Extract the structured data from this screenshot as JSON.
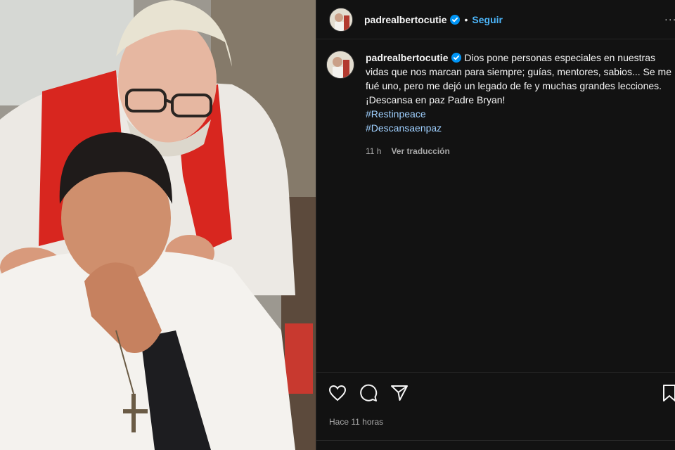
{
  "header": {
    "username": "padrealbertocutie",
    "separator": "•",
    "follow_label": "Seguir",
    "more_label": "..."
  },
  "post": {
    "image_icon": "photo-priest-blessing",
    "caption": {
      "username": "padrealbertocutie",
      "text": "Dios pone personas especiales en nuestras vidas que nos marcan para siempre; guías, mentores, sabios... Se me fué uno, pero me dejó un legado de fe y muchas grandes lecciones. ¡Descansa en paz Padre Bryan!",
      "hashtags": [
        "#Restinpeace",
        "#Descansaenpaz"
      ]
    },
    "age": "11 h",
    "translate_label": "Ver traducción",
    "timestamp": "Hace 11 horas"
  },
  "actions": {
    "like_icon": "heart-icon",
    "comment_icon": "comment-icon",
    "share_icon": "send-icon",
    "save_icon": "bookmark-icon"
  },
  "colors": {
    "background": "#121212",
    "link": "#4cb5f9",
    "hashtag": "#9fd0ff",
    "muted": "#a8a8a8",
    "verified": "#0095f6"
  }
}
